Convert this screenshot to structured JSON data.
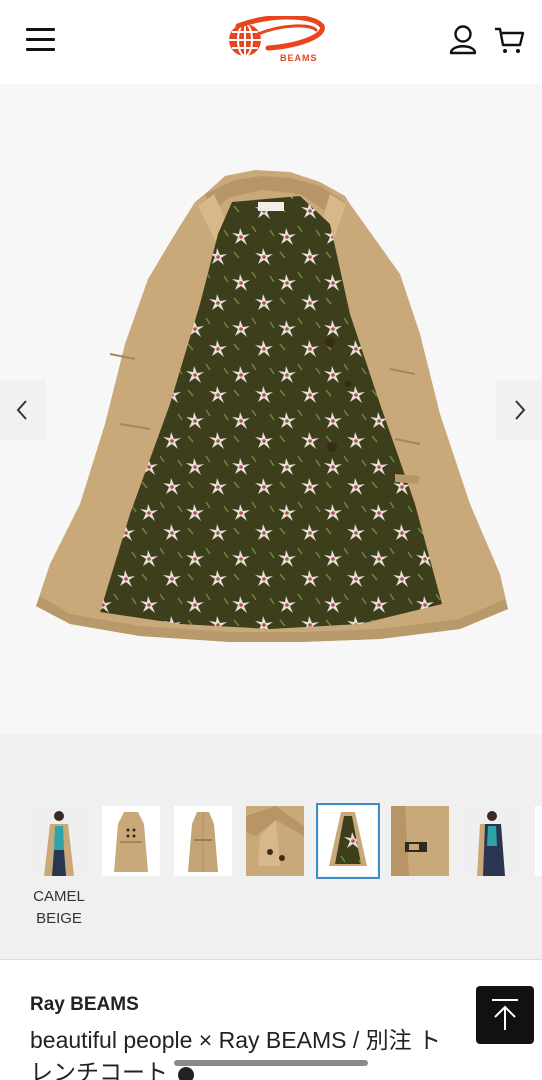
{
  "header": {
    "logo_text": "BEAMS",
    "colors": {
      "logo": "#e8451f",
      "icons": "#111111"
    }
  },
  "hero": {
    "prev_icon": "chevron-left-icon",
    "next_icon": "chevron-right-icon"
  },
  "thumbnails": {
    "active_index": 4,
    "color_label_line1": "CAMEL",
    "color_label_line2": "BEIGE"
  },
  "product": {
    "brand": "Ray BEAMS",
    "title_line1": "beautiful people × Ray BEAMS / 別注 ト",
    "title_line2": "レンチコート"
  },
  "back_to_top_icon": "arrow-up-icon",
  "colors": {
    "accent_outline": "#3a8fc8",
    "coat_beige": "#c9a97a",
    "lining_green": "#3d3f1c"
  }
}
